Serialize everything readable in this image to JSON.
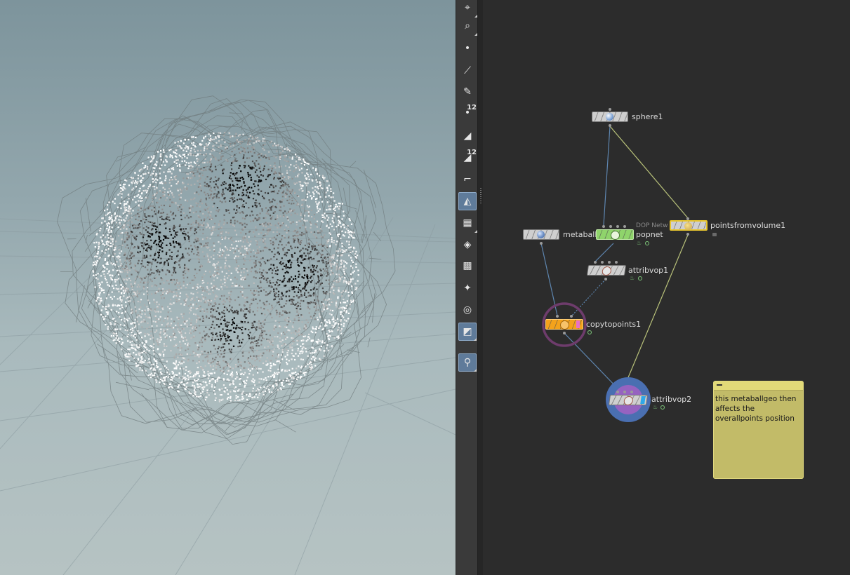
{
  "shelf_tools": [
    {
      "icon": "view-tool-icon",
      "badge": ""
    },
    {
      "icon": "camera-handle-icon",
      "badge": ""
    },
    {
      "icon": "point-select-icon",
      "badge": ""
    },
    {
      "icon": "edge-select-icon",
      "badge": ""
    },
    {
      "icon": "pin-brush-icon",
      "badge": ""
    },
    {
      "icon": "point-numbers-icon",
      "badge": "12"
    },
    {
      "icon": "primitive-select-icon",
      "badge": ""
    },
    {
      "icon": "primitive-numbers-icon",
      "badge": "12"
    },
    {
      "icon": "edge-curve-icon",
      "badge": ""
    },
    {
      "icon": "shaded-mode-icon",
      "badge": ""
    },
    {
      "icon": "texture-checker-icon",
      "badge": ""
    },
    {
      "icon": "display-diamond-icon",
      "badge": ""
    },
    {
      "icon": "uv-grid-icon",
      "badge": ""
    },
    {
      "icon": "light-display-icon",
      "badge": ""
    },
    {
      "icon": "ghost-other-icon",
      "badge": ""
    },
    {
      "icon": "background-image-icon",
      "badge": ""
    },
    {
      "icon": "map-pin-icon",
      "badge": ""
    }
  ],
  "network": {
    "nodes": {
      "sphere1": {
        "label": "sphere1"
      },
      "metaball1": {
        "label": "metaball1"
      },
      "popnet": {
        "label": "popnet",
        "sublabel": "DOP Netw"
      },
      "pointsfromvolume1": {
        "label": "pointsfromvolume1"
      },
      "attribvop1": {
        "label": "attribvop1"
      },
      "copytopoints1": {
        "label": "copytopoints1"
      },
      "attribvop2": {
        "label": "attribvop2"
      }
    },
    "sticky_note": {
      "text": "this metaballgeo then affects the overallpoints position"
    }
  },
  "colors": {
    "popnet_node": "#8fd46b",
    "pointsfromvolume_outline": "#e8c62e",
    "copytopoints_node": "#f4a21b",
    "sticky_note": "#c2bb68",
    "wire_blue": "#5e86b0",
    "wire_yellow": "#b9c27a"
  }
}
